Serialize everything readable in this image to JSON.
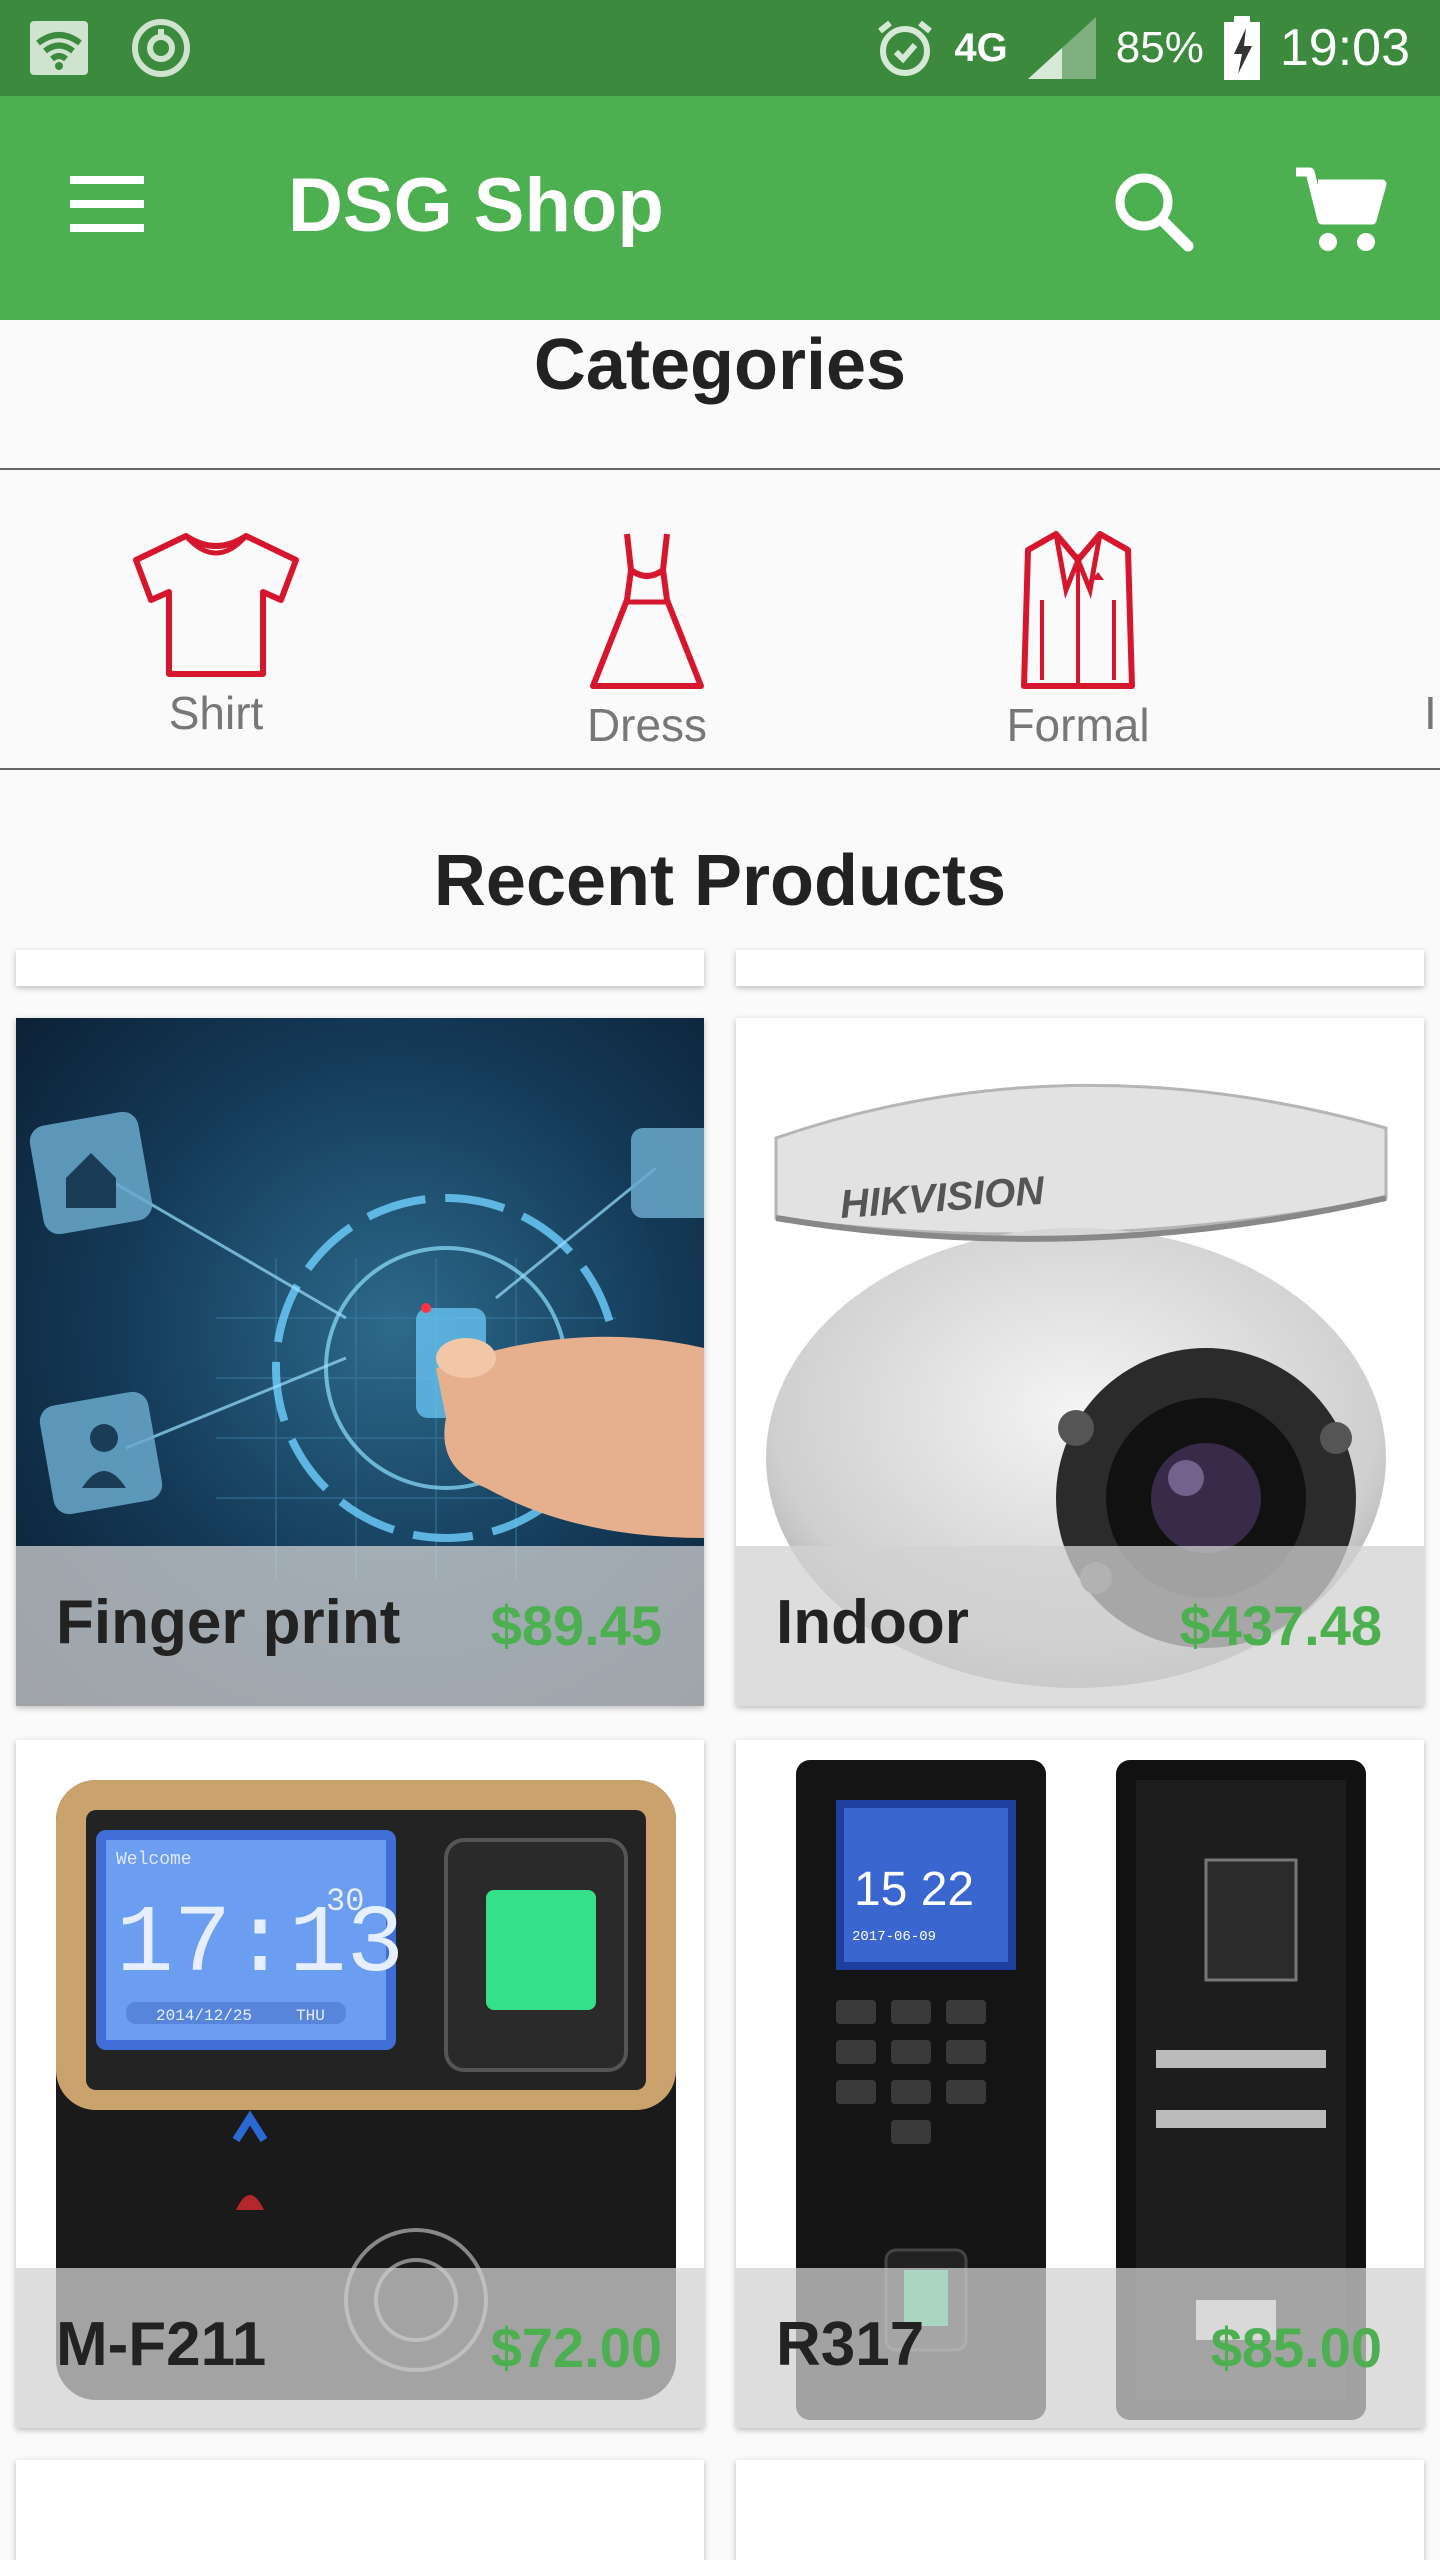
{
  "status_bar": {
    "battery": "85%",
    "time": "19:03",
    "network": "4G"
  },
  "app_bar": {
    "title": "DSG Shop"
  },
  "categories_section": {
    "title": "Categories",
    "items": [
      {
        "label": "Shirt",
        "icon": "shirt-icon"
      },
      {
        "label": "Dress",
        "icon": "dress-icon"
      },
      {
        "label": "Formal",
        "icon": "formal-suit-icon"
      },
      {
        "label": "I",
        "icon": "category-icon"
      }
    ]
  },
  "recent_section": {
    "title": "Recent Products",
    "products": [
      {
        "name": "Finger print",
        "price": "$89.45"
      },
      {
        "name": "Indoor",
        "price": "$437.48"
      },
      {
        "name": "M-F211",
        "price": "$72.00"
      },
      {
        "name": "R317",
        "price": "$85.00"
      }
    ],
    "overlay_text": {
      "camera_brand": "HIKVISION",
      "device1_time": "17:13",
      "device1_seconds": "30",
      "device1_date": "2014/12/25",
      "device1_day": "THU",
      "device1_welcome": "Welcome",
      "device2_time": "15 22",
      "device2_date": "2017-06-09"
    }
  },
  "colors": {
    "primary": "#4caf50",
    "primary_dark": "#3c8a3e",
    "category_icon": "#d6162d",
    "price": "#4caf50"
  }
}
